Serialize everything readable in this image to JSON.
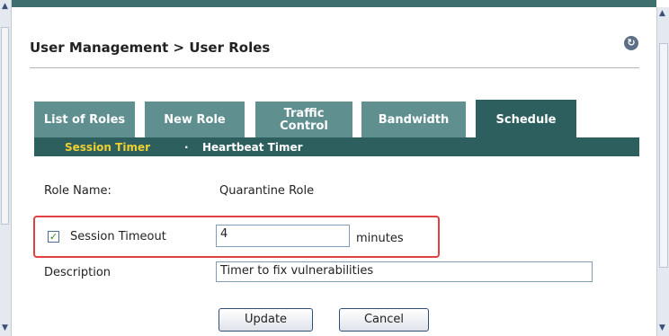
{
  "breadcrumb": "User Management > User Roles",
  "tabs": [
    {
      "label": "List of Roles"
    },
    {
      "label": "New Role"
    },
    {
      "label": "Traffic Control"
    },
    {
      "label": "Bandwidth"
    },
    {
      "label": "Schedule"
    }
  ],
  "active_tab": "Schedule",
  "subtabs": [
    {
      "label": "Session Timer"
    },
    {
      "label": "Heartbeat Timer"
    }
  ],
  "subtab_separator": "·",
  "form": {
    "role_name_label": "Role Name:",
    "role_name_value": "Quarantine Role",
    "session_timeout_label": "Session Timeout",
    "session_timeout_checked": true,
    "session_timeout_value": "4",
    "session_timeout_unit": "minutes",
    "description_label": "Description",
    "description_value": "Timer to fix vulnerabilities"
  },
  "buttons": {
    "update": "Update",
    "cancel": "Cancel"
  },
  "colors": {
    "tab_bg": "#608f8f",
    "tab_active_bg": "#2e5f5f",
    "active_subtab": "#f0d030",
    "highlight_border": "#e04040"
  },
  "icons": {
    "refresh": "refresh-icon"
  }
}
